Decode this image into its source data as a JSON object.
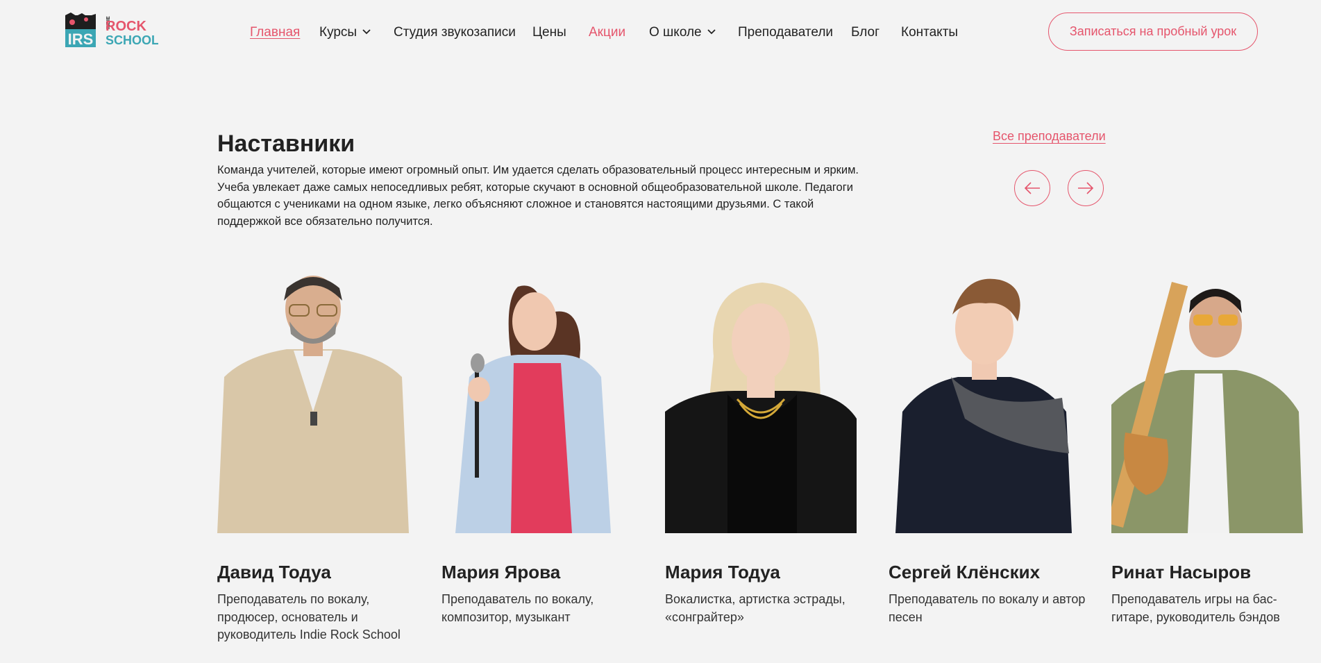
{
  "header": {
    "logo": {
      "line1": "INDIE",
      "line2": "ROCK",
      "line3": "SCHOOL",
      "mark": "IRS"
    },
    "nav": [
      {
        "label": "Главная"
      },
      {
        "label": "Курсы"
      },
      {
        "label": "Студия звукозаписи"
      },
      {
        "label": "Цены"
      },
      {
        "label": "Акции"
      },
      {
        "label": "О школе"
      },
      {
        "label": "Преподаватели"
      },
      {
        "label": "Блог"
      },
      {
        "label": "Контакты"
      }
    ],
    "cta": "Записаться на пробный урок"
  },
  "section": {
    "title": "Наставники",
    "description": "Команда учителей, которые имеют огромный опыт. Им удается сделать образовательный процесс интересным и ярким. Учеба увлекает даже самых непоседливых ребят, которые скучают в основной общеобразовательной школе. Педагоги общаются с учениками на одном языке, легко объясняют сложное и становятся настоящими друзьями. С такой поддержкой все обязательно получится.",
    "all_link": "Все преподаватели"
  },
  "teachers": [
    {
      "name": "Давид Тодуа",
      "role": "Преподаватель по вокалу, продюсер, основатель и руководитель Indie Rock School"
    },
    {
      "name": "Мария Ярова",
      "role": "Преподаватель по вокалу, композитор, музыкант"
    },
    {
      "name": "Мария Тодуа",
      "role": "Вокалистка, артистка эстрады, «сонграйтер»"
    },
    {
      "name": "Сергей Клёнских",
      "role": "Преподаватель по вокалу и автор песен"
    },
    {
      "name": "Ринат Насыров",
      "role": "Преподаватель игры на бас-гитаре, руководитель бэндов"
    }
  ],
  "colors": {
    "accent": "#e5556c",
    "background": "#f3f3f3",
    "text": "#222222"
  }
}
